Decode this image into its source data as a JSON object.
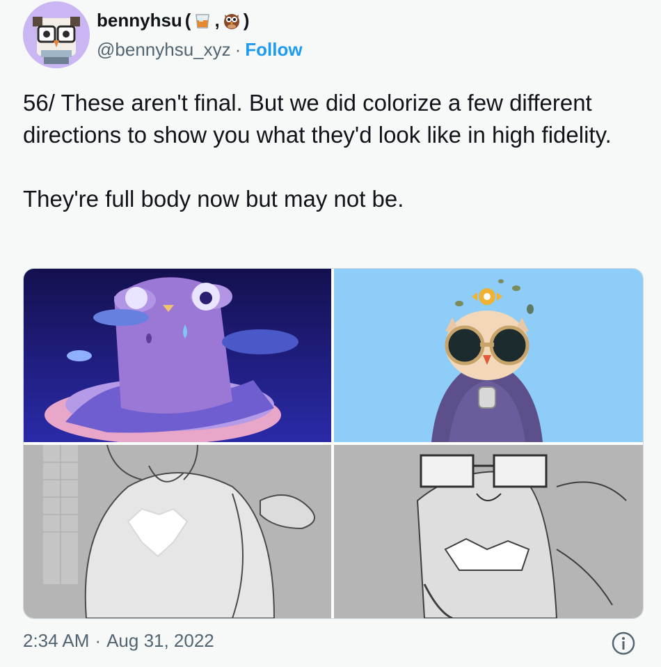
{
  "author": {
    "display_name": "bennyhsu",
    "name_open": "(",
    "name_separator": ",",
    "name_close": ")",
    "name_emojis": [
      "whisky-glass-icon",
      "owl-icon"
    ],
    "handle": "@bennyhsu_xyz",
    "separator": "·",
    "follow_label": "Follow",
    "avatar": "pixel-owl-avatar"
  },
  "tweet": {
    "paragraphs": [
      "56/ These aren't final. But we did colorize a few different directions to show you what they'd look like in high fidelity.",
      "They're full body now but may not be."
    ]
  },
  "media": [
    {
      "name": "purple-owl-artwork"
    },
    {
      "name": "goggles-owl-artwork"
    },
    {
      "name": "heart-owl-sketch"
    },
    {
      "name": "glasses-owl-sketch"
    }
  ],
  "footer": {
    "time": "2:34 AM",
    "separator": "·",
    "date": "Aug 31, 2022",
    "info_icon": "info-icon"
  },
  "colors": {
    "accent": "#1d9bf0",
    "text": "#0f1419",
    "secondary_text": "#536471",
    "background": "#f7f9f9",
    "border": "#cfd9de"
  }
}
